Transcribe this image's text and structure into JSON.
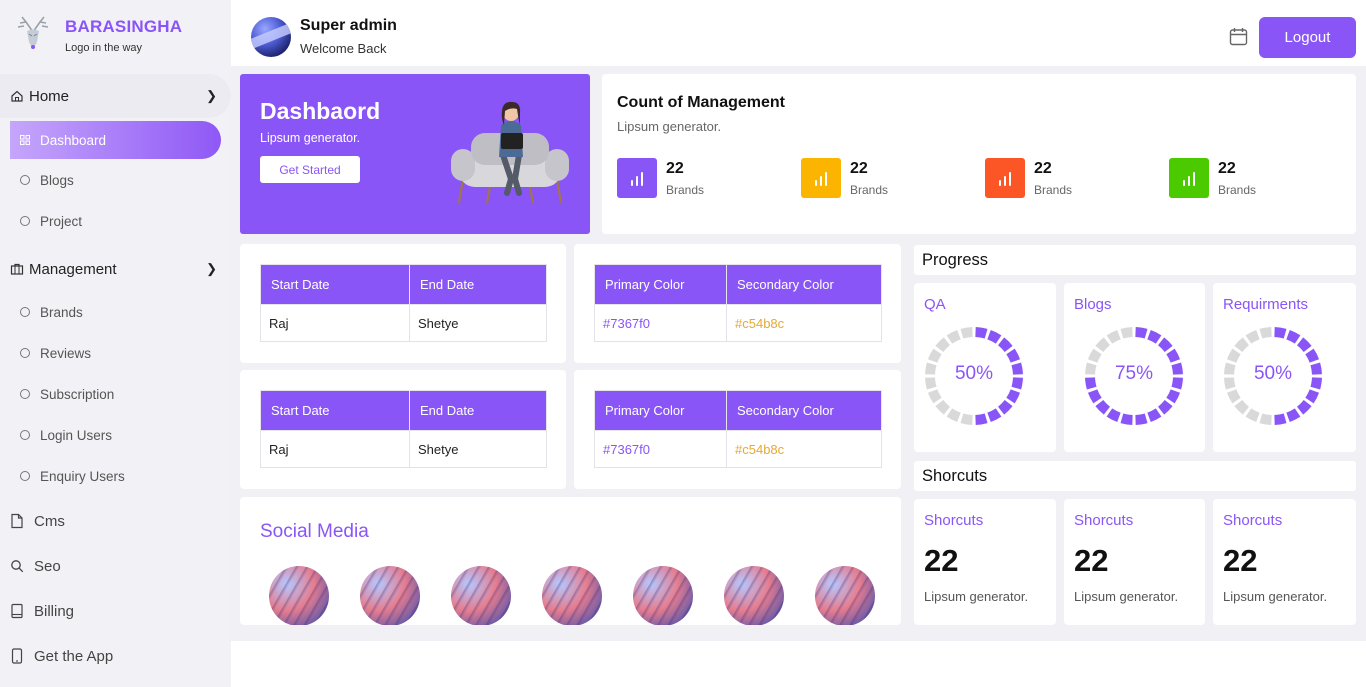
{
  "brand": {
    "name": "BARASINGHA",
    "tagline": "Logo in the way"
  },
  "sidebar": {
    "home": {
      "label": "Home",
      "icon": "home-icon"
    },
    "home_items": [
      {
        "label": "Dashboard",
        "active": true
      },
      {
        "label": "Blogs"
      },
      {
        "label": "Project"
      }
    ],
    "management": {
      "label": "Management",
      "icon": "briefcase-icon"
    },
    "management_items": [
      {
        "label": "Brands"
      },
      {
        "label": "Reviews"
      },
      {
        "label": "Subscription"
      },
      {
        "label": "Login Users"
      },
      {
        "label": "Enquiry Users"
      }
    ],
    "bottom_items": [
      {
        "label": "Cms",
        "icon": "file-icon"
      },
      {
        "label": "Seo",
        "icon": "search-icon"
      },
      {
        "label": "Billing",
        "icon": "book-icon"
      },
      {
        "label": "Get the App",
        "icon": "phone-icon"
      }
    ]
  },
  "header": {
    "title": "Super admin",
    "subtitle": "Welcome Back",
    "logout_label": "Logout"
  },
  "hero": {
    "title": "Dashbaord",
    "subtitle": "Lipsum generator.",
    "button_label": "Get Started"
  },
  "count": {
    "title": "Count of Management",
    "subtitle": "Lipsum generator.",
    "stats": [
      {
        "value": "22",
        "label": "Brands",
        "color": "#8a55f7"
      },
      {
        "value": "22",
        "label": "Brands",
        "color": "#fbb400"
      },
      {
        "value": "22",
        "label": "Brands",
        "color": "#fc5626"
      },
      {
        "value": "22",
        "label": "Brands",
        "color": "#4cca00"
      }
    ]
  },
  "date_tables": [
    {
      "headers": [
        "Start Date",
        "End Date"
      ],
      "row": [
        "Raj",
        "Shetye"
      ]
    },
    {
      "headers": [
        "Start Date",
        "End Date"
      ],
      "row": [
        "Raj",
        "Shetye"
      ]
    }
  ],
  "color_tables": [
    {
      "headers": [
        "Primary Color",
        "Secondary Color"
      ],
      "row": [
        "#7367f0",
        "#c54b8c"
      ]
    },
    {
      "headers": [
        "Primary Color",
        "Secondary Color"
      ],
      "row": [
        "#7367f0",
        "#c54b8c"
      ]
    }
  ],
  "progress": {
    "title": "Progress",
    "items": [
      {
        "label": "QA",
        "value_text": "50%",
        "fraction": 0.5
      },
      {
        "label": "Blogs",
        "value_text": "75%",
        "fraction": 0.75
      },
      {
        "label": "Requirments",
        "value_text": "50%",
        "fraction": 0.5
      }
    ]
  },
  "shortcuts": {
    "title": "Shorcuts",
    "items": [
      {
        "label": "Shorcuts",
        "value": "22",
        "sub": "Lipsum generator."
      },
      {
        "label": "Shorcuts",
        "value": "22",
        "sub": "Lipsum generator."
      },
      {
        "label": "Shorcuts",
        "value": "22",
        "sub": "Lipsum generator."
      }
    ]
  },
  "social": {
    "title": "Social Media",
    "count": 7
  },
  "colors": {
    "accent": "#8a55f7",
    "track": "#d9d9d9",
    "secondary_text": "#e8a832"
  }
}
